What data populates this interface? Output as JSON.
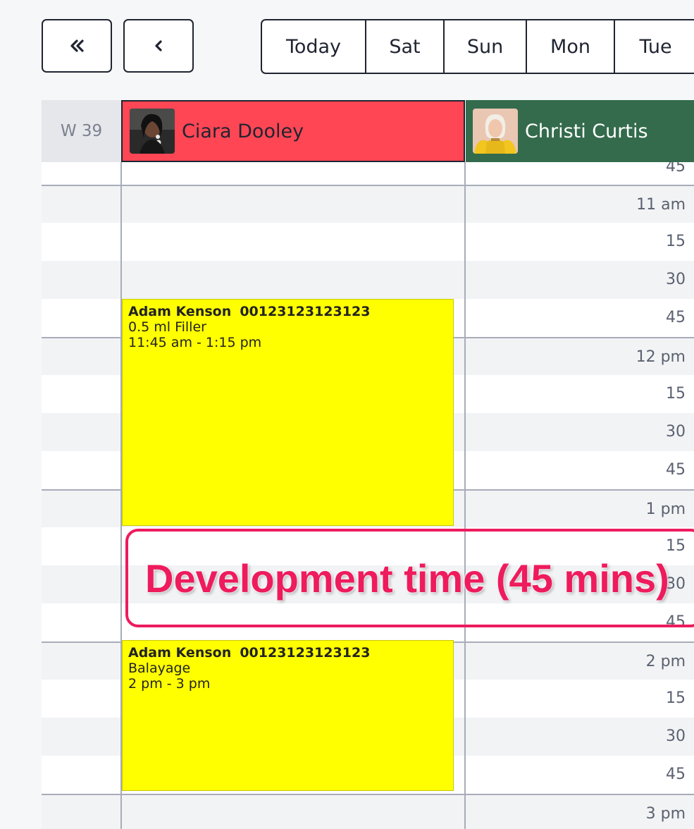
{
  "toolbar": {
    "first_icon": "chevrons-left-icon",
    "prev_icon": "chevron-left-icon",
    "days": [
      "Today",
      "Sat",
      "Sun",
      "Mon",
      "Tue"
    ]
  },
  "calendar": {
    "week_label": "W 39",
    "staff": [
      {
        "name": "Ciara Dooley",
        "color": "#ff4655",
        "selected": true
      },
      {
        "name": "Christi Curtis",
        "color": "#336b4c",
        "selected": false
      }
    ],
    "time_labels": [
      "45",
      "11 am",
      "15",
      "30",
      "45",
      "12 pm",
      "15",
      "30",
      "45",
      "1 pm",
      "15",
      "30",
      "45",
      "2 pm",
      "15",
      "30",
      "45",
      "3 pm"
    ],
    "appointments": [
      {
        "client": "Adam Kenson",
        "phone": "00123123123123",
        "service": "0.5 ml Filler",
        "time": "11:45 am - 1:15 pm",
        "color": "#ffff00"
      },
      {
        "client": "Adam Kenson",
        "phone": "00123123123123",
        "service": "Balayage",
        "time": "2 pm - 3 pm",
        "color": "#ffff00"
      }
    ],
    "annotation": "Development time (45 mins)",
    "annotation_color": "#ee1b5d"
  }
}
